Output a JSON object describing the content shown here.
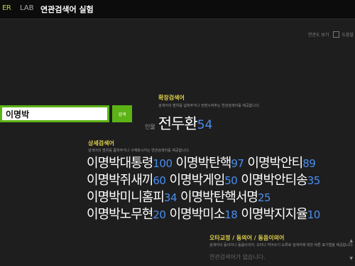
{
  "header": {
    "brand": "ER",
    "lab": "LAB",
    "title": "연관검색어 실험",
    "option_label": "연관도 보기",
    "option_checkbox_label": "도움말"
  },
  "search": {
    "value": "이명박",
    "button_label": "검색"
  },
  "expanded": {
    "title": "확장검색어",
    "description": "검색어의 범위를 넓혀주거나 전환시켜주는 연관검색어를 제공합니다.",
    "prefix": "인물",
    "term": "전두환",
    "count": "54"
  },
  "detailed": {
    "title": "상세검색어",
    "description": "검색어의 범위를 좁혀주거나 구체화시키는 연관검색어를 제공합니다.",
    "items": [
      {
        "term": "이명박대통령",
        "count": "100"
      },
      {
        "term": "이명박탄핵",
        "count": "97"
      },
      {
        "term": "이명박안티",
        "count": "89"
      },
      {
        "term": "이명박쥐새끼",
        "count": "60"
      },
      {
        "term": "이명박게임",
        "count": "50"
      },
      {
        "term": "이명박안티송",
        "count": "35"
      },
      {
        "term": "이명박미니홈피",
        "count": "34"
      },
      {
        "term": "이명박탄핵서명",
        "count": "25"
      },
      {
        "term": "이명박노무현",
        "count": "20"
      },
      {
        "term": "이명박미소",
        "count": "18"
      },
      {
        "term": "이명박지지율",
        "count": "10"
      }
    ]
  },
  "typo": {
    "title": "오타교정 / 동의어 / 동음이의어",
    "description": "검색어의 동의어나 동음이의어, 오타나 띄어쓰기 오류로 검색어에 대한 바른 표기법을 제공합니다.",
    "empty": "연관검색어가 없습니다."
  },
  "scroll": {
    "up": "▲",
    "down": "▼"
  },
  "colors": {
    "background": "#1e1e1e",
    "accent_green": "#5cb316",
    "section_title": "#e0d04a",
    "count_blue": "#4a8ef0"
  }
}
